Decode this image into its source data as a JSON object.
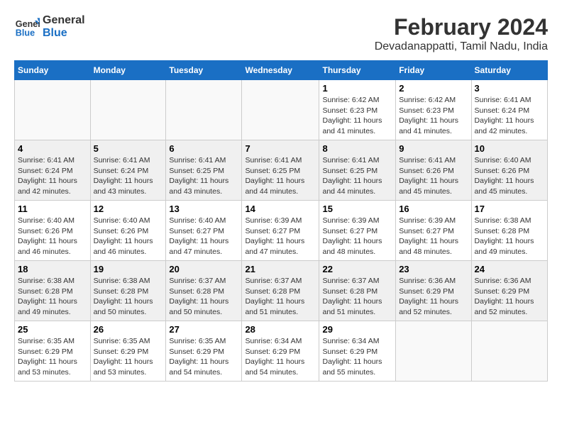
{
  "header": {
    "logo_line1": "General",
    "logo_line2": "Blue",
    "title": "February 2024",
    "subtitle": "Devadanappatti, Tamil Nadu, India"
  },
  "days_of_week": [
    "Sunday",
    "Monday",
    "Tuesday",
    "Wednesday",
    "Thursday",
    "Friday",
    "Saturday"
  ],
  "weeks": [
    [
      {
        "num": "",
        "detail": ""
      },
      {
        "num": "",
        "detail": ""
      },
      {
        "num": "",
        "detail": ""
      },
      {
        "num": "",
        "detail": ""
      },
      {
        "num": "1",
        "detail": "Sunrise: 6:42 AM\nSunset: 6:23 PM\nDaylight: 11 hours\nand 41 minutes."
      },
      {
        "num": "2",
        "detail": "Sunrise: 6:42 AM\nSunset: 6:23 PM\nDaylight: 11 hours\nand 41 minutes."
      },
      {
        "num": "3",
        "detail": "Sunrise: 6:41 AM\nSunset: 6:24 PM\nDaylight: 11 hours\nand 42 minutes."
      }
    ],
    [
      {
        "num": "4",
        "detail": "Sunrise: 6:41 AM\nSunset: 6:24 PM\nDaylight: 11 hours\nand 42 minutes."
      },
      {
        "num": "5",
        "detail": "Sunrise: 6:41 AM\nSunset: 6:24 PM\nDaylight: 11 hours\nand 43 minutes."
      },
      {
        "num": "6",
        "detail": "Sunrise: 6:41 AM\nSunset: 6:25 PM\nDaylight: 11 hours\nand 43 minutes."
      },
      {
        "num": "7",
        "detail": "Sunrise: 6:41 AM\nSunset: 6:25 PM\nDaylight: 11 hours\nand 44 minutes."
      },
      {
        "num": "8",
        "detail": "Sunrise: 6:41 AM\nSunset: 6:25 PM\nDaylight: 11 hours\nand 44 minutes."
      },
      {
        "num": "9",
        "detail": "Sunrise: 6:41 AM\nSunset: 6:26 PM\nDaylight: 11 hours\nand 45 minutes."
      },
      {
        "num": "10",
        "detail": "Sunrise: 6:40 AM\nSunset: 6:26 PM\nDaylight: 11 hours\nand 45 minutes."
      }
    ],
    [
      {
        "num": "11",
        "detail": "Sunrise: 6:40 AM\nSunset: 6:26 PM\nDaylight: 11 hours\nand 46 minutes."
      },
      {
        "num": "12",
        "detail": "Sunrise: 6:40 AM\nSunset: 6:26 PM\nDaylight: 11 hours\nand 46 minutes."
      },
      {
        "num": "13",
        "detail": "Sunrise: 6:40 AM\nSunset: 6:27 PM\nDaylight: 11 hours\nand 47 minutes."
      },
      {
        "num": "14",
        "detail": "Sunrise: 6:39 AM\nSunset: 6:27 PM\nDaylight: 11 hours\nand 47 minutes."
      },
      {
        "num": "15",
        "detail": "Sunrise: 6:39 AM\nSunset: 6:27 PM\nDaylight: 11 hours\nand 48 minutes."
      },
      {
        "num": "16",
        "detail": "Sunrise: 6:39 AM\nSunset: 6:27 PM\nDaylight: 11 hours\nand 48 minutes."
      },
      {
        "num": "17",
        "detail": "Sunrise: 6:38 AM\nSunset: 6:28 PM\nDaylight: 11 hours\nand 49 minutes."
      }
    ],
    [
      {
        "num": "18",
        "detail": "Sunrise: 6:38 AM\nSunset: 6:28 PM\nDaylight: 11 hours\nand 49 minutes."
      },
      {
        "num": "19",
        "detail": "Sunrise: 6:38 AM\nSunset: 6:28 PM\nDaylight: 11 hours\nand 50 minutes."
      },
      {
        "num": "20",
        "detail": "Sunrise: 6:37 AM\nSunset: 6:28 PM\nDaylight: 11 hours\nand 50 minutes."
      },
      {
        "num": "21",
        "detail": "Sunrise: 6:37 AM\nSunset: 6:28 PM\nDaylight: 11 hours\nand 51 minutes."
      },
      {
        "num": "22",
        "detail": "Sunrise: 6:37 AM\nSunset: 6:28 PM\nDaylight: 11 hours\nand 51 minutes."
      },
      {
        "num": "23",
        "detail": "Sunrise: 6:36 AM\nSunset: 6:29 PM\nDaylight: 11 hours\nand 52 minutes."
      },
      {
        "num": "24",
        "detail": "Sunrise: 6:36 AM\nSunset: 6:29 PM\nDaylight: 11 hours\nand 52 minutes."
      }
    ],
    [
      {
        "num": "25",
        "detail": "Sunrise: 6:35 AM\nSunset: 6:29 PM\nDaylight: 11 hours\nand 53 minutes."
      },
      {
        "num": "26",
        "detail": "Sunrise: 6:35 AM\nSunset: 6:29 PM\nDaylight: 11 hours\nand 53 minutes."
      },
      {
        "num": "27",
        "detail": "Sunrise: 6:35 AM\nSunset: 6:29 PM\nDaylight: 11 hours\nand 54 minutes."
      },
      {
        "num": "28",
        "detail": "Sunrise: 6:34 AM\nSunset: 6:29 PM\nDaylight: 11 hours\nand 54 minutes."
      },
      {
        "num": "29",
        "detail": "Sunrise: 6:34 AM\nSunset: 6:29 PM\nDaylight: 11 hours\nand 55 minutes."
      },
      {
        "num": "",
        "detail": ""
      },
      {
        "num": "",
        "detail": ""
      }
    ]
  ]
}
